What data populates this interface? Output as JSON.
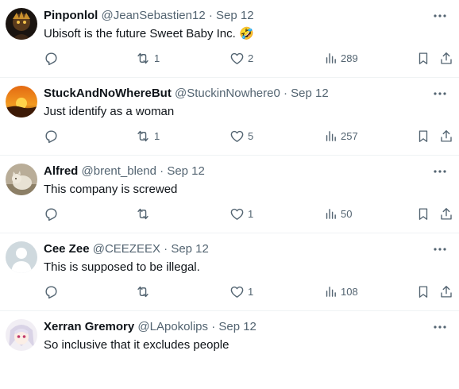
{
  "posts": [
    {
      "name": "Pinponlol",
      "handle": "@JeanSebastien12",
      "date": "Sep 12",
      "text": "Ubisoft is the future Sweet Baby Inc. 🤣",
      "replies": "",
      "retweets": "1",
      "likes": "2",
      "views": "289",
      "avatar": "dark-figure-avatar"
    },
    {
      "name": "StuckAndNoWhereBut",
      "handle": "@StuckinNowhere0",
      "date": "Sep 12",
      "text": "Just identify as a woman",
      "replies": "",
      "retweets": "1",
      "likes": "5",
      "views": "257",
      "avatar": "sunset-avatar"
    },
    {
      "name": "Alfred",
      "handle": "@brent_blend",
      "date": "Sep 12",
      "text": "This company is screwed",
      "replies": "",
      "retweets": "",
      "likes": "1",
      "views": "50",
      "avatar": "cat-avatar"
    },
    {
      "name": "Cee Zee",
      "handle": "@CEEZEEX",
      "date": "Sep 12",
      "text": "This is supposed to be illegal.",
      "replies": "",
      "retweets": "",
      "likes": "1",
      "views": "108",
      "avatar": "default-avatar"
    },
    {
      "name": "Xerran Gremory",
      "handle": "@LApokolips",
      "date": "Sep 12",
      "text": "So inclusive that it excludes people",
      "replies": "",
      "retweets": "",
      "likes": "",
      "views": "",
      "avatar": "anime-avatar"
    }
  ],
  "separator": "·",
  "colors": {
    "text": "#0f1419",
    "secondary": "#536471",
    "divider": "#eff3f4"
  }
}
